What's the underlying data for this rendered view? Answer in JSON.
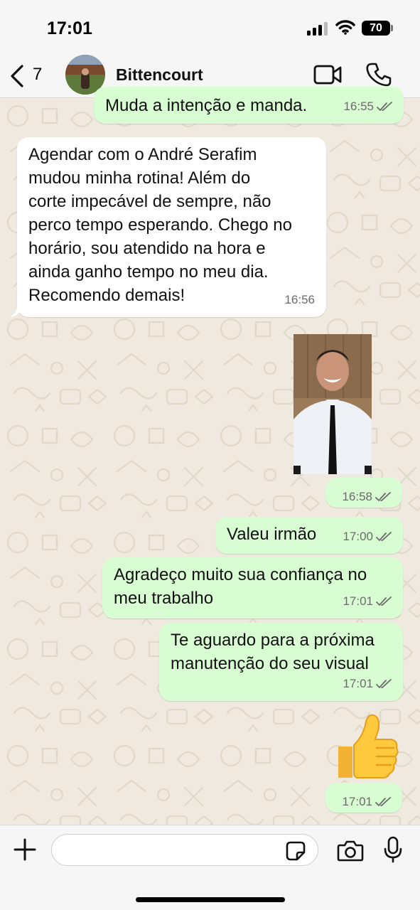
{
  "status_bar": {
    "time": "17:01",
    "battery": "70"
  },
  "header": {
    "back_count": "7",
    "contact_name": "Bittencourt"
  },
  "messages": [
    {
      "direction": "out",
      "text": "Muda a intenção e manda.",
      "time": "16:55"
    },
    {
      "direction": "in",
      "lines": [
        "Agendar com o André Serafim",
        "mudou minha rotina! Além do",
        "corte impecável de sempre, não",
        "perco tempo esperando. Chego no",
        "horário, sou atendido na hora e",
        "ainda ganho tempo no meu dia.",
        "Recomendo demais!"
      ],
      "time": "16:56"
    },
    {
      "direction": "out",
      "type": "photo",
      "time": "16:58"
    },
    {
      "direction": "out",
      "text": "Valeu irmão",
      "time": "17:00"
    },
    {
      "direction": "out",
      "lines": [
        "Agradeço muito sua confiança no",
        "meu trabalho"
      ],
      "time": "17:01"
    },
    {
      "direction": "out",
      "lines": [
        "Te aguardo para a próxima",
        "manutenção do seu visual"
      ],
      "time": "17:01"
    },
    {
      "direction": "out",
      "type": "emoji",
      "emoji": "👍",
      "time": "17:01"
    }
  ],
  "colors": {
    "outgoing_bubble": "#d9fdd3",
    "incoming_bubble": "#ffffff",
    "wallpaper": "#efe9df",
    "read_ticks": "#6b6b6b"
  },
  "icons": [
    "back-chevron-icon",
    "video-call-icon",
    "phone-icon",
    "plus-icon",
    "sticker-icon",
    "camera-icon",
    "microphone-icon",
    "double-check-icon"
  ]
}
